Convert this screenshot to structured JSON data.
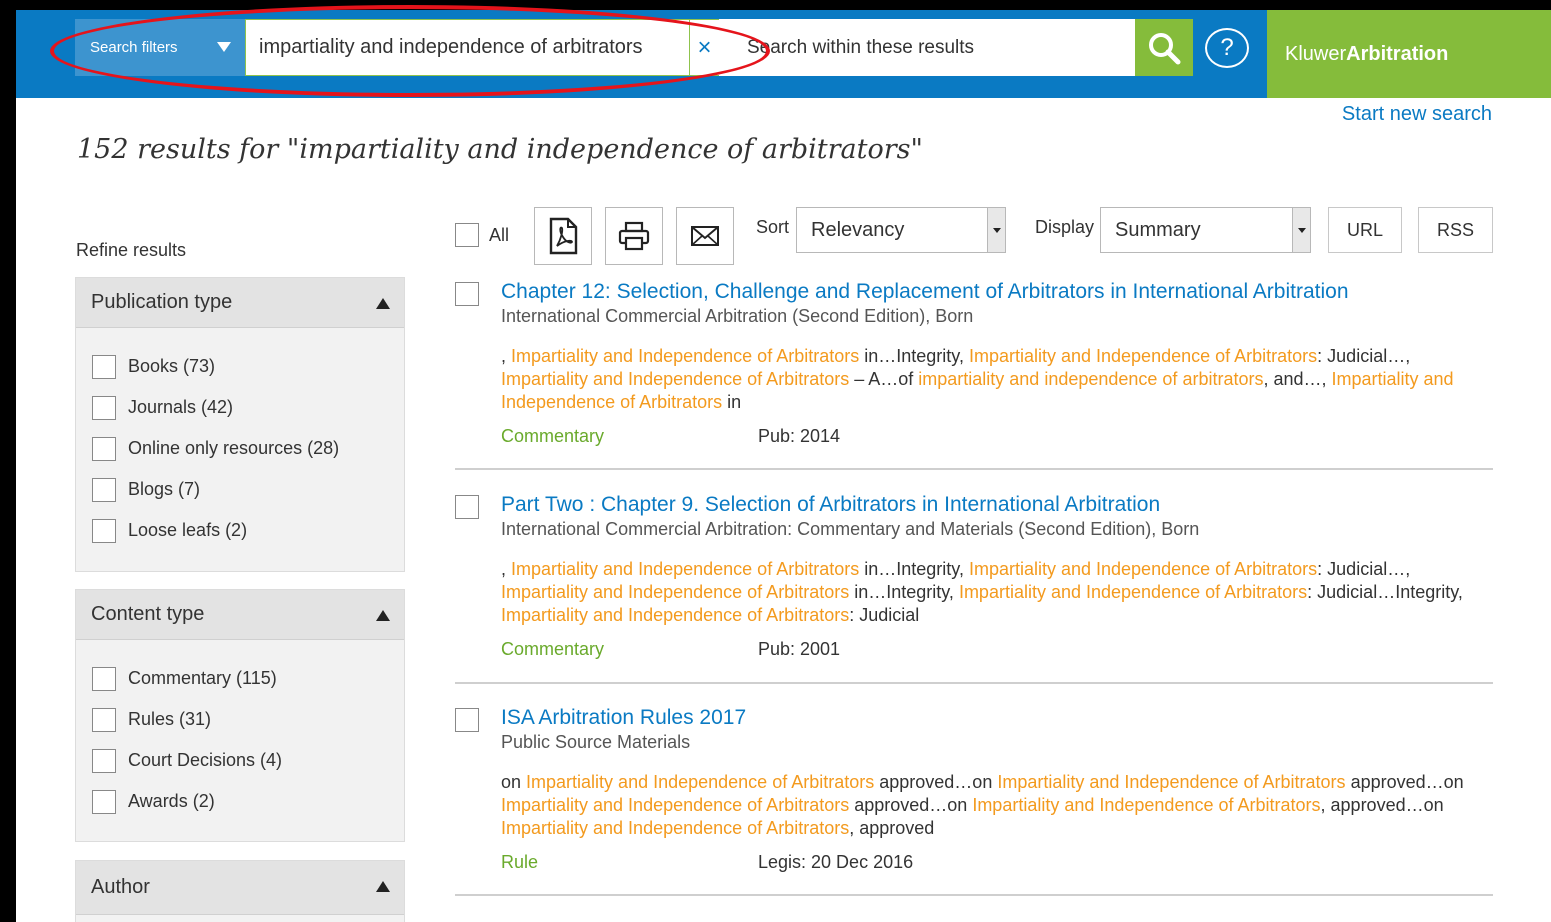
{
  "header": {
    "filters_label": "Search filters",
    "query": "impartiality and independence of arbitrators",
    "clear": "×",
    "within_placeholder": "Search within these results",
    "help": "?",
    "brand_light": "Kluwer",
    "brand_bold": "Arbitration"
  },
  "start_new_search": "Start new search",
  "results_title": "152 results for \"impartiality and independence of arbitrators\"",
  "refine_label": "Refine results",
  "facets": [
    {
      "title": "Publication type",
      "items": [
        "Books (73)",
        "Journals (42)",
        "Online only resources (28)",
        "Blogs (7)",
        "Loose leafs (2)"
      ]
    },
    {
      "title": "Content type",
      "items": [
        "Commentary (115)",
        "Rules (31)",
        "Court Decisions (4)",
        "Awards (2)"
      ]
    },
    {
      "title": "Author",
      "items": []
    }
  ],
  "toolbar": {
    "all_label": "All",
    "sort_label": "Sort",
    "sort_value": "Relevancy",
    "display_label": "Display",
    "display_value": "Summary",
    "url_label": "URL",
    "rss_label": "RSS",
    "icons": [
      "pdf-icon",
      "print-icon",
      "email-icon"
    ]
  },
  "colors": {
    "brand_blue": "#0a7ac3",
    "brand_green": "#85bc3b",
    "highlight": "#f39a1e",
    "annotation_red": "#e5141b"
  },
  "results": [
    {
      "title": "Chapter 12: Selection, Challenge and Replacement of Arbitrators in International Arbitration",
      "source": "International Commercial Arbitration (Second Edition), Born",
      "snippet": [
        {
          "t": ", ",
          "h": false
        },
        {
          "t": "Impartiality and Independence of Arbitrators",
          "h": true
        },
        {
          "t": " in…Integrity, ",
          "h": false
        },
        {
          "t": "Impartiality and Independence of Arbitrators",
          "h": true
        },
        {
          "t": ": Judicial…, ",
          "h": false
        },
        {
          "t": "Impartiality and Independence of Arbitrators",
          "h": true
        },
        {
          "t": " – A…of ",
          "h": false
        },
        {
          "t": "impartiality and independence of arbitrators",
          "h": true
        },
        {
          "t": ", and…, ",
          "h": false
        },
        {
          "t": "Impartiality and Independence of Arbitrators",
          "h": true
        },
        {
          "t": " in",
          "h": false
        }
      ],
      "type": "Commentary",
      "date": "Pub: 2014"
    },
    {
      "title": "Part Two : Chapter 9. Selection of Arbitrators in International Arbitration",
      "source": "International Commercial Arbitration: Commentary and Materials (Second Edition), Born",
      "snippet": [
        {
          "t": ", ",
          "h": false
        },
        {
          "t": "Impartiality and Independence of Arbitrators",
          "h": true
        },
        {
          "t": " in…Integrity, ",
          "h": false
        },
        {
          "t": "Impartiality and Independence of Arbitrators",
          "h": true
        },
        {
          "t": ": Judicial…, ",
          "h": false
        },
        {
          "t": "Impartiality and Independence of Arbitrators",
          "h": true
        },
        {
          "t": " in…Integrity, ",
          "h": false
        },
        {
          "t": "Impartiality and Independence of Arbitrators",
          "h": true
        },
        {
          "t": ": Judicial…Integrity, ",
          "h": false
        },
        {
          "t": "Impartiality and Independence of Arbitrators",
          "h": true
        },
        {
          "t": ": Judicial",
          "h": false
        }
      ],
      "type": "Commentary",
      "date": "Pub: 2001"
    },
    {
      "title": "ISA Arbitration Rules 2017",
      "source": "Public Source Materials",
      "snippet": [
        {
          "t": "on ",
          "h": false
        },
        {
          "t": "Impartiality and Independence of Arbitrators",
          "h": true
        },
        {
          "t": " approved…on ",
          "h": false
        },
        {
          "t": "Impartiality and Independence of Arbitrators",
          "h": true
        },
        {
          "t": " approved…on ",
          "h": false
        },
        {
          "t": "Impartiality and Independence of Arbitrators",
          "h": true
        },
        {
          "t": " approved…on ",
          "h": false
        },
        {
          "t": "Impartiality and Independence of Arbitrators",
          "h": true
        },
        {
          "t": ", approved…on ",
          "h": false
        },
        {
          "t": "Impartiality and Independence of Arbitrators",
          "h": true
        },
        {
          "t": ", approved",
          "h": false
        }
      ],
      "type": "Rule",
      "date": "Legis: 20 Dec 2016"
    }
  ]
}
